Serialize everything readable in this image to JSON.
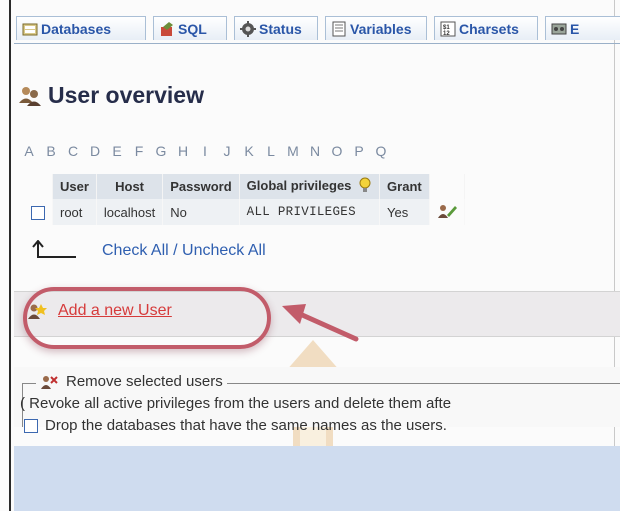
{
  "tabs": [
    {
      "label": "Databases",
      "icon": "database-icon"
    },
    {
      "label": "SQL",
      "icon": "sql-icon"
    },
    {
      "label": "Status",
      "icon": "status-icon"
    },
    {
      "label": "Variables",
      "icon": "variables-icon"
    },
    {
      "label": "Charsets",
      "icon": "charsets-icon"
    },
    {
      "label": "E",
      "icon": "engines-icon"
    }
  ],
  "page_title": "User overview",
  "letters": [
    "A",
    "B",
    "C",
    "D",
    "E",
    "F",
    "G",
    "H",
    "I",
    "J",
    "K",
    "L",
    "M",
    "N",
    "O",
    "P",
    "Q"
  ],
  "table": {
    "headers": [
      "User",
      "Host",
      "Password",
      "Global privileges",
      "Grant"
    ],
    "rows": [
      {
        "user": "root",
        "host": "localhost",
        "password": "No",
        "privileges": "ALL PRIVILEGES",
        "grant": "Yes"
      }
    ]
  },
  "check_all": "Check All / Uncheck All",
  "add_user": "Add a new User",
  "remove": {
    "legend": "Remove selected users",
    "revoke": "( Revoke all active privileges from the users and delete them afte",
    "drop": "Drop the databases that have the same names as the users."
  },
  "colors": {
    "link_blue": "#2f5fb0",
    "link_red": "#d63b3b",
    "highlight": "#c25c6a",
    "footer_blue": "#cfdcef"
  }
}
